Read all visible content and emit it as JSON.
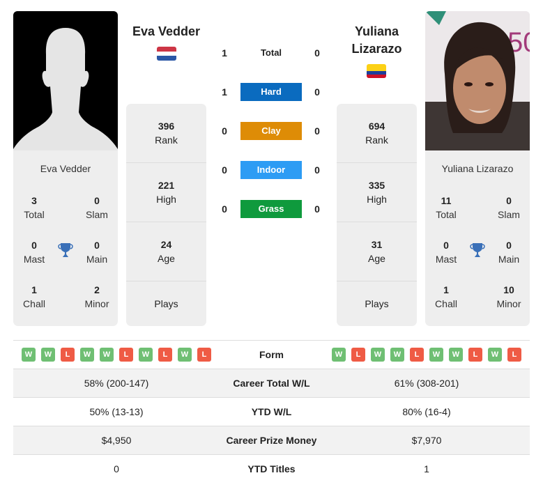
{
  "colors": {
    "hard": "#0a6bbf",
    "clay": "#de8c06",
    "indoor": "#2d9cf4",
    "grass": "#0f9a3d",
    "win": "#6fbf73",
    "loss": "#ef5b45",
    "trophy": "#3a70b8"
  },
  "player1": {
    "name": "Eva Vedder",
    "flag": "netherlands-flag",
    "photo": "silhouette-placeholder",
    "titles": {
      "total": {
        "value": "3",
        "label": "Total"
      },
      "slam": {
        "value": "0",
        "label": "Slam"
      },
      "mast": {
        "value": "0",
        "label": "Mast"
      },
      "main": {
        "value": "0",
        "label": "Main"
      },
      "chall": {
        "value": "1",
        "label": "Chall"
      },
      "minor": {
        "value": "2",
        "label": "Minor"
      }
    },
    "stats": [
      {
        "value": "396",
        "label": "Rank"
      },
      {
        "value": "221",
        "label": "High"
      },
      {
        "value": "24",
        "label": "Age"
      },
      {
        "value": "",
        "label": "Plays"
      }
    ],
    "form": [
      "W",
      "W",
      "L",
      "W",
      "W",
      "L",
      "W",
      "L",
      "W",
      "L"
    ]
  },
  "player2": {
    "name": "Yuliana Lizarazo",
    "name_line1": "Yuliana",
    "name_line2": "Lizarazo",
    "flag": "colombia-flag",
    "photo": "player-photo",
    "titles": {
      "total": {
        "value": "11",
        "label": "Total"
      },
      "slam": {
        "value": "0",
        "label": "Slam"
      },
      "mast": {
        "value": "0",
        "label": "Mast"
      },
      "main": {
        "value": "0",
        "label": "Main"
      },
      "chall": {
        "value": "1",
        "label": "Chall"
      },
      "minor": {
        "value": "10",
        "label": "Minor"
      }
    },
    "stats": [
      {
        "value": "694",
        "label": "Rank"
      },
      {
        "value": "335",
        "label": "High"
      },
      {
        "value": "31",
        "label": "Age"
      },
      {
        "value": "",
        "label": "Plays"
      }
    ],
    "form": [
      "W",
      "L",
      "W",
      "W",
      "L",
      "W",
      "W",
      "L",
      "W",
      "L"
    ]
  },
  "h2h": {
    "total": {
      "label": "Total",
      "p1": "1",
      "p2": "0"
    },
    "surfaces": [
      {
        "label": "Hard",
        "p1": "1",
        "p2": "0"
      },
      {
        "label": "Clay",
        "p1": "0",
        "p2": "0"
      },
      {
        "label": "Indoor",
        "p1": "0",
        "p2": "0"
      },
      {
        "label": "Grass",
        "p1": "0",
        "p2": "0"
      }
    ]
  },
  "comparison": [
    {
      "label": "Form",
      "p1": "",
      "p2": ""
    },
    {
      "label": "Career Total W/L",
      "p1": "58% (200-147)",
      "p2": "61% (308-201)"
    },
    {
      "label": "YTD W/L",
      "p1": "50% (13-13)",
      "p2": "80% (16-4)"
    },
    {
      "label": "Career Prize Money",
      "p1": "$4,950",
      "p2": "$7,970"
    },
    {
      "label": "YTD Titles",
      "p1": "0",
      "p2": "1"
    }
  ]
}
